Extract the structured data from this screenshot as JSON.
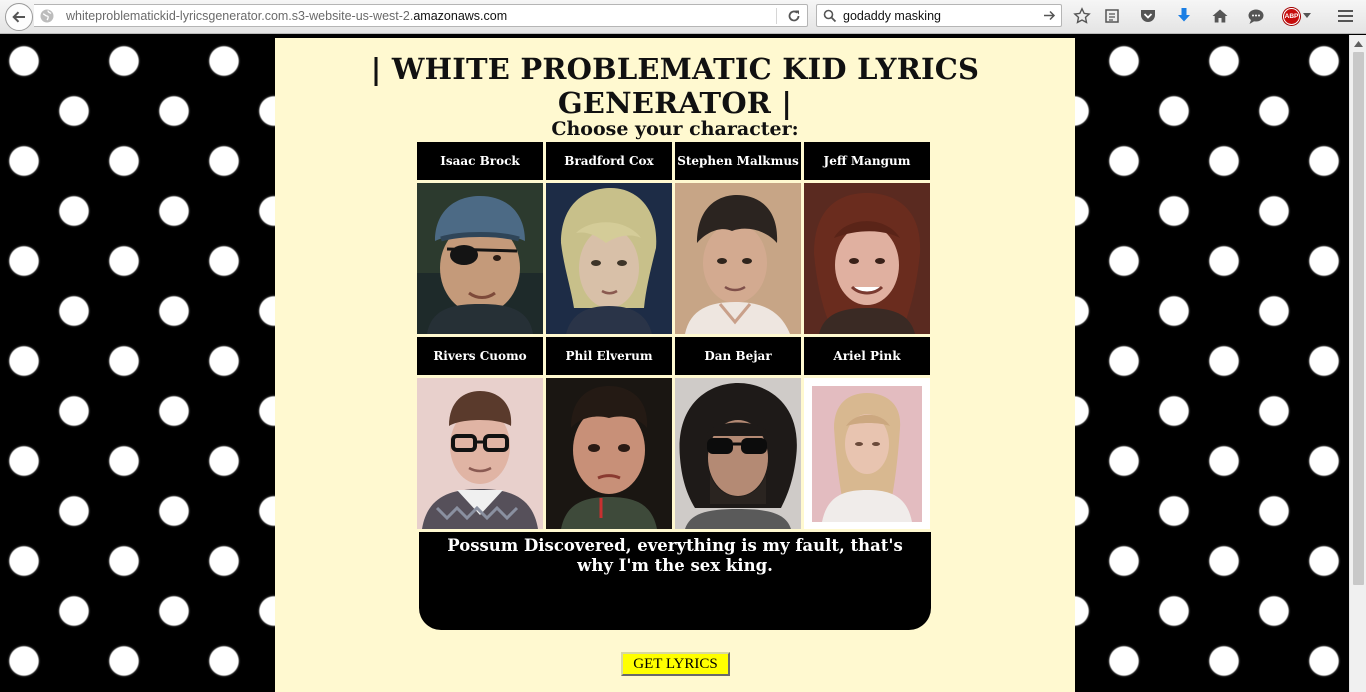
{
  "browser": {
    "url_prefix": "whiteproblematickid-lyricsgenerator.com.s3-website-us-west-2.",
    "url_domain": "amazonaws.com",
    "search_query": "godaddy masking",
    "abp_label": "ABP",
    "icons": [
      "back-arrow-icon",
      "globe-icon",
      "reload-icon",
      "search-icon",
      "go-arrow-icon",
      "star-icon",
      "reading-list-icon",
      "pocket-icon",
      "download-icon",
      "home-icon",
      "chat-icon",
      "adblock-plus-icon",
      "menu-icon"
    ]
  },
  "page": {
    "title": "| WHITE PROBLEMATIC KID LYRICS GENERATOR |",
    "subtitle": "Choose your character:",
    "characters": [
      {
        "name": "Isaac Brock"
      },
      {
        "name": "Bradford Cox"
      },
      {
        "name": "Stephen Malkmus"
      },
      {
        "name": "Jeff Mangum"
      },
      {
        "name": "Rivers Cuomo"
      },
      {
        "name": "Phil Elverum"
      },
      {
        "name": "Dan Bejar"
      },
      {
        "name": "Ariel Pink"
      }
    ],
    "lyrics": "Possum Discovered, everything is my fault, that's why I'm the sex king.",
    "button_label": "GET LYRICS"
  },
  "colors": {
    "panel_bg": "#fff9d0",
    "button_bg": "#ffff00",
    "tab_bg": "#000000"
  }
}
